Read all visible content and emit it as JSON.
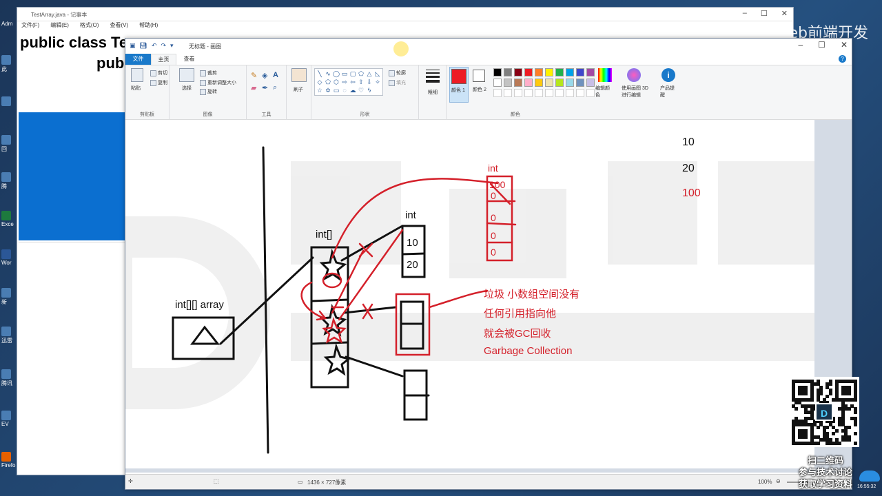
{
  "brand_overlay": "渡一教育-Web前端开发",
  "notepad": {
    "title": "TestArray.java - 记事本",
    "menu": [
      "文件(F)",
      "编辑(E)",
      "格式(O)",
      "查看(V)",
      "帮助(H)"
    ],
    "code_line1": "public class Te",
    "code_line2": "pub"
  },
  "desktop_icons": [
    "Adm",
    "此",
    "",
    "回",
    "腾",
    "Exce",
    "Wor",
    "新",
    "迅雷",
    "腾讯",
    "EV",
    "Firefo"
  ],
  "paint": {
    "title": "无标题 - 画图",
    "tabs": {
      "file": "文件",
      "home": "主页",
      "view": "查看"
    },
    "groups": {
      "clipboard": {
        "label": "剪贴板",
        "paste": "粘贴",
        "cut": "剪切",
        "copy": "复制"
      },
      "image": {
        "label": "图像",
        "select": "选择",
        "crop": "裁剪",
        "resize": "重新调整大小",
        "rotate": "旋转"
      },
      "tools": {
        "label": "工具"
      },
      "brushes": {
        "label": "刷子"
      },
      "shapes": {
        "label": "形状",
        "outline": "轮廓",
        "fill": "填充"
      },
      "size": {
        "label": "粗细"
      },
      "colors": {
        "label": "颜色",
        "color1": "颜色 1",
        "color2": "颜色 2",
        "edit": "编辑颜色",
        "paint3d": "使用画图 3D 进行编辑",
        "alert": "产品提醒"
      }
    },
    "palette": [
      "#000000",
      "#7f7f7f",
      "#880015",
      "#ed1c24",
      "#ff7f27",
      "#fff200",
      "#22b14c",
      "#00a2e8",
      "#3f48cc",
      "#a349a4",
      "#ffffff",
      "#c3c3c3",
      "#b97a57",
      "#ffaec9",
      "#ffc90e",
      "#efe4b0",
      "#b5e61d",
      "#99d9ea",
      "#7092be",
      "#c8bfe7"
    ],
    "status": {
      "dimensions": "1436 × 727像素",
      "zoom": "100%"
    }
  },
  "canvas": {
    "values_right": [
      "10",
      "20",
      "100"
    ],
    "label_array": "int[][] array",
    "label_int_arr": "int[]",
    "label_int_top": "int",
    "label_int_red": "int",
    "small_array_values": [
      "10",
      "20"
    ],
    "red_array_values": [
      "100",
      "0",
      "0",
      "0",
      "0"
    ],
    "note_lines": [
      "垃圾 小数组空间没有",
      "任何引用指向他",
      "就会被GC回收",
      "Garbage  Collection"
    ],
    "colors": {
      "red": "#d4202a",
      "black": "#111111"
    }
  },
  "promo": {
    "line1": "扫二维码",
    "line2": "参与技术讨论",
    "line3": "获取学习资料"
  },
  "clock": "16:55:32"
}
